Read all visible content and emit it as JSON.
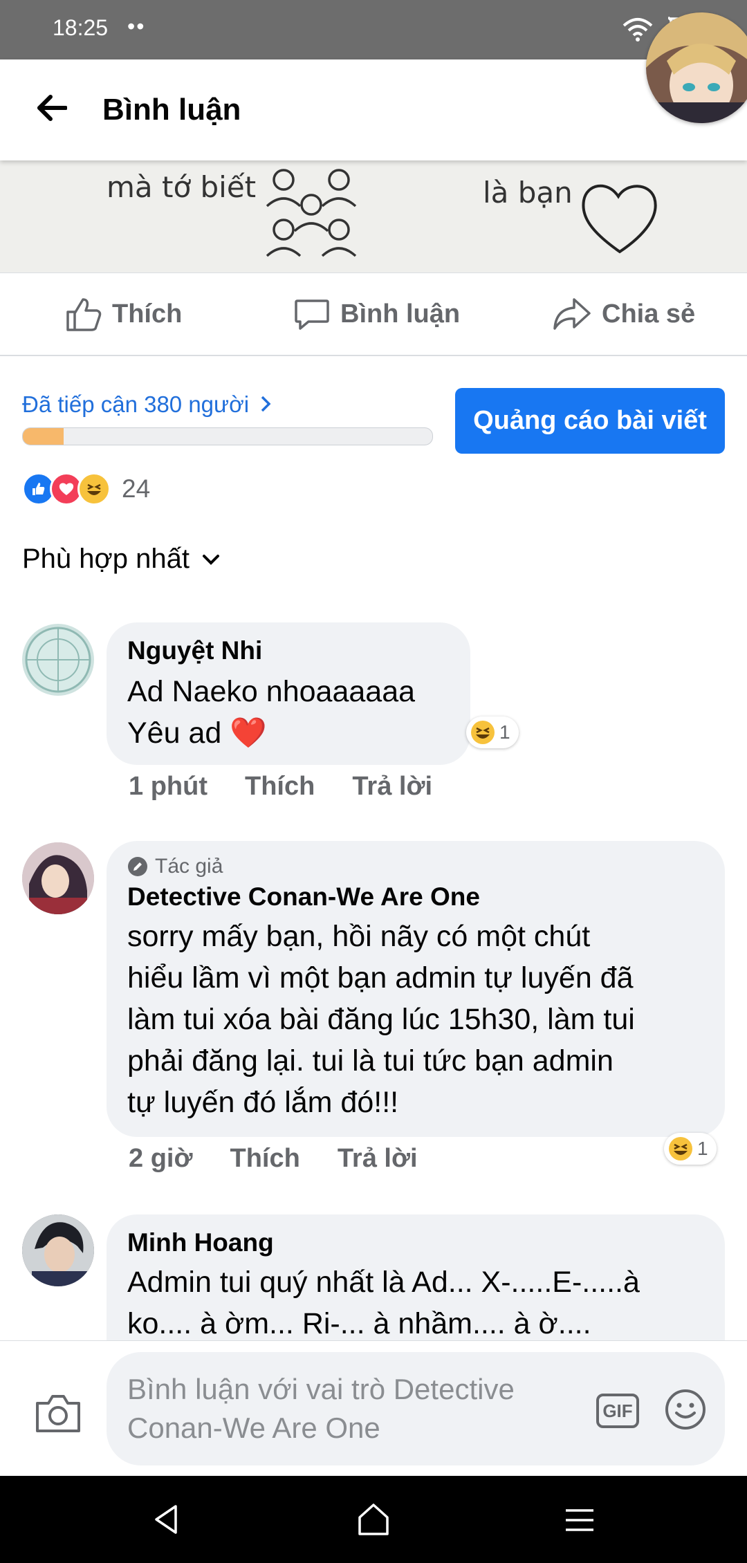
{
  "status_bar": {
    "time": "18:25",
    "dots": "••"
  },
  "header": {
    "title": "Bình luận"
  },
  "post_image": {
    "left_text": "mà tớ biết",
    "right_text": "là bạn"
  },
  "actions": {
    "like": "Thích",
    "comment": "Bình luận",
    "share": "Chia sẻ"
  },
  "reach": {
    "text": "Đã tiếp cận 380 người",
    "progress_fraction": 0.1
  },
  "promote_button": "Quảng cáo bài viết",
  "reactions": {
    "count": "24"
  },
  "sort": {
    "label": "Phù hợp nhất"
  },
  "comments": [
    {
      "author": "Nguyệt Nhi",
      "lines": [
        "Ad Naeko nhoaaaaaa",
        "Yêu ad"
      ],
      "heart_emoji": "❤️",
      "time": "1 phút",
      "like": "Thích",
      "reply": "Trả lời",
      "reaction_count": "1"
    },
    {
      "badge": "Tác giả",
      "author": "Detective Conan-We Are One",
      "lines": [
        "sorry mấy bạn, hồi nãy có một chút",
        "hiểu lầm vì một bạn admin tự luyến đã",
        "làm tui xóa bài đăng lúc 15h30, làm tui",
        "phải đăng lại. tui là tui tức bạn admin",
        "tự luyến đó lắm đó!!!"
      ],
      "time": "2 giờ",
      "like": "Thích",
      "reply": "Trả lời",
      "reaction_count": "1"
    },
    {
      "author": "Minh Hoang",
      "lines": [
        "Admin tui quý nhất là Ad... X-.....E-.....à",
        "ko.... à ờm... Ri-... à nhầm.... à ờ...."
      ]
    }
  ],
  "composer": {
    "placeholder": "Bình luận với vai trò Detective Conan-We Are One",
    "gif_label": "GIF"
  },
  "colors": {
    "accent": "#1877f2",
    "link": "#216fdb",
    "bubble": "#f0f2f5",
    "muted": "#65676b"
  }
}
